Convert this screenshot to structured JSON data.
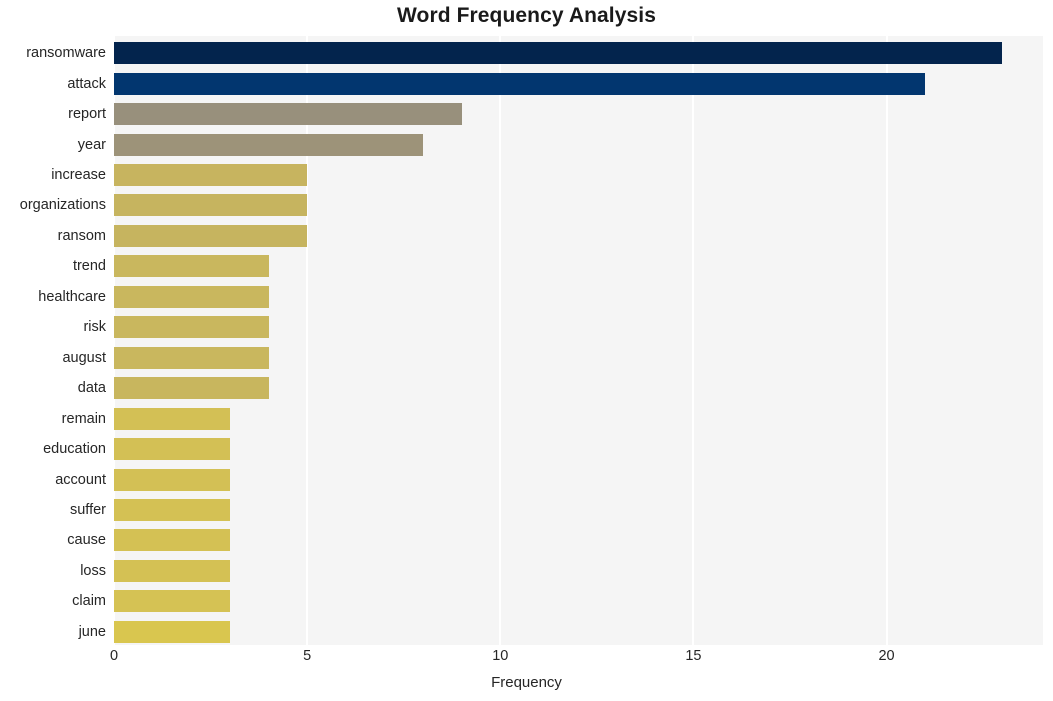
{
  "chart_data": {
    "type": "bar",
    "orientation": "horizontal",
    "title": "Word Frequency Analysis",
    "xlabel": "Frequency",
    "ylabel": "",
    "xlim": [
      0,
      24.05
    ],
    "xticks": [
      0,
      5,
      10,
      15,
      20
    ],
    "xticklabels": [
      "0",
      "5",
      "10",
      "15",
      "20"
    ],
    "grid": "vertical-white-on-gray",
    "legend": "none",
    "categories": [
      "ransomware",
      "attack",
      "report",
      "year",
      "increase",
      "organizations",
      "ransom",
      "trend",
      "healthcare",
      "risk",
      "august",
      "data",
      "remain",
      "education",
      "account",
      "suffer",
      "cause",
      "loss",
      "claim",
      "june"
    ],
    "values": [
      23,
      21,
      9,
      8,
      5,
      5,
      5,
      4,
      4,
      4,
      4,
      4,
      3,
      3,
      3,
      3,
      3,
      3,
      3,
      3
    ],
    "bar_colors": [
      "#03244d",
      "#02366f",
      "#98907c",
      "#9d9379",
      "#c7b45f",
      "#c6b45f",
      "#c6b45f",
      "#c9b75e",
      "#c9b75e",
      "#c9b75e",
      "#c9b75e",
      "#c8b65e",
      "#d3c055",
      "#d3c055",
      "#d3c055",
      "#d4c154",
      "#d4c154",
      "#d4c154",
      "#d5c254",
      "#d9c64f"
    ],
    "plot_background": "#f5f5f5",
    "figure_background": "#ffffff",
    "gridline_color": "#ffffff",
    "text_color": "#262626"
  },
  "figure": {
    "title": "Word Frequency Analysis",
    "x_axis_title": "Frequency"
  }
}
